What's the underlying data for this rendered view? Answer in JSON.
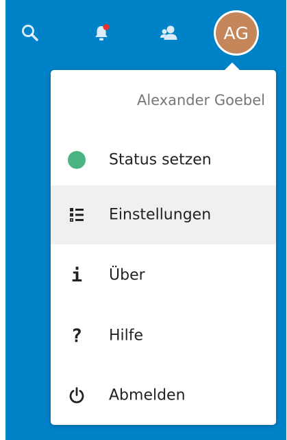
{
  "colors": {
    "header_bg": "#0082c9",
    "avatar_bg": "#c5875a",
    "status_online": "#49b382",
    "notification_dot": "#e9322d",
    "active_row_bg": "#f0f0f0"
  },
  "header": {
    "icons": [
      "search-icon",
      "notifications-icon",
      "contacts-icon"
    ],
    "avatar": {
      "initials": "AG"
    }
  },
  "user_menu": {
    "display_name": "Alexander Goebel",
    "items": [
      {
        "label": "Status setzen",
        "icon": "status-online-dot"
      },
      {
        "label": "Einstellungen",
        "icon": "settings-list-icon",
        "active": true
      },
      {
        "label": "Über",
        "icon": "info-icon",
        "glyph": "i"
      },
      {
        "label": "Hilfe",
        "icon": "help-icon",
        "glyph": "?"
      },
      {
        "label": "Abmelden",
        "icon": "power-icon"
      }
    ]
  }
}
